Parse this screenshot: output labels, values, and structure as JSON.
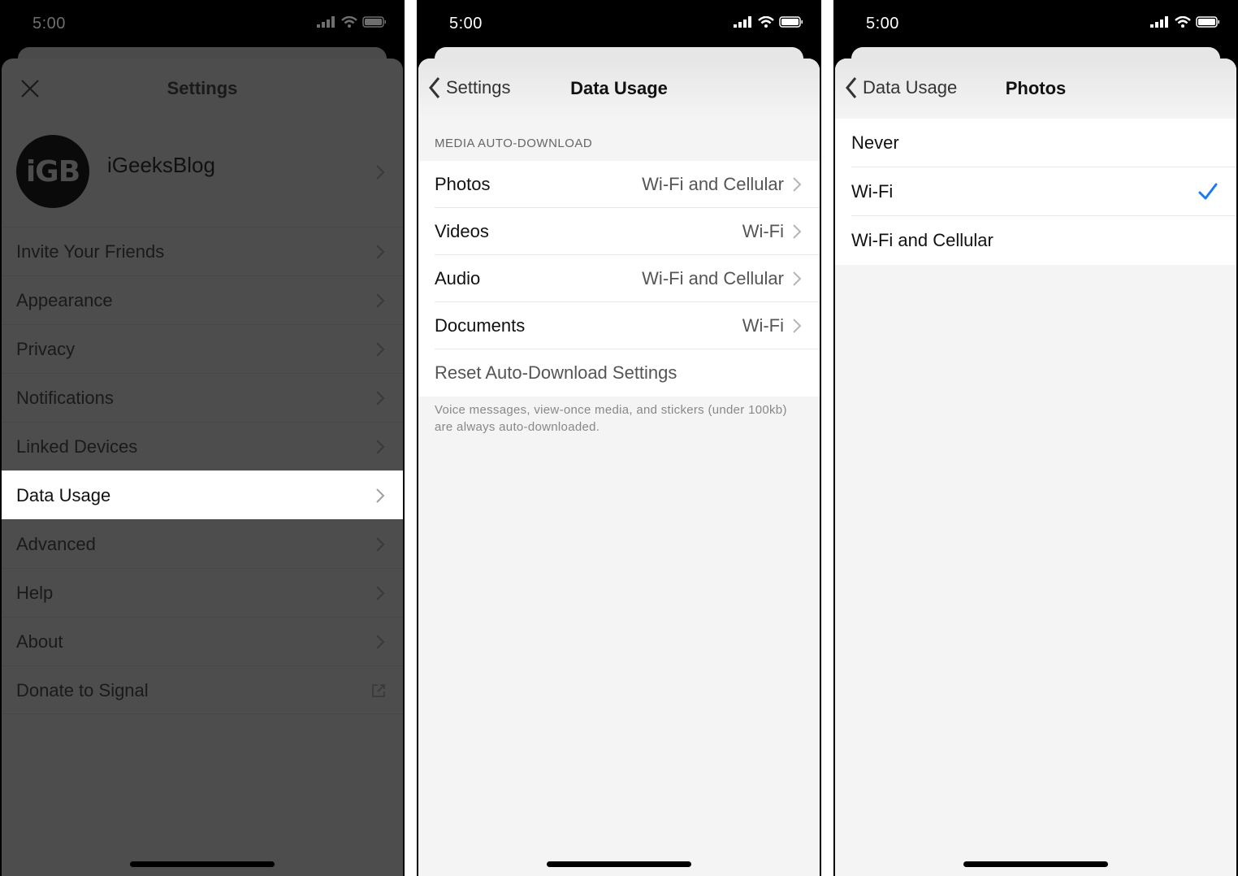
{
  "status_bar": {
    "time": "5:00"
  },
  "screen1": {
    "title": "Settings",
    "profile": {
      "avatar_text": "iGB",
      "name": "iGeeksBlog"
    },
    "items": [
      {
        "label": "Invite Your Friends",
        "icon": "chevron-right-icon"
      },
      {
        "label": "Appearance",
        "icon": "chevron-right-icon"
      },
      {
        "label": "Privacy",
        "icon": "chevron-right-icon"
      },
      {
        "label": "Notifications",
        "icon": "chevron-right-icon"
      },
      {
        "label": "Linked Devices",
        "icon": "chevron-right-icon"
      },
      {
        "label": "Data Usage",
        "icon": "chevron-right-icon",
        "highlighted": true
      },
      {
        "label": "Advanced",
        "icon": "chevron-right-icon"
      },
      {
        "label": "Help",
        "icon": "chevron-right-icon"
      },
      {
        "label": "About",
        "icon": "chevron-right-icon"
      },
      {
        "label": "Donate to Signal",
        "icon": "external-link-icon"
      }
    ]
  },
  "screen2": {
    "back_label": "Settings",
    "title": "Data Usage",
    "section_header": "MEDIA AUTO-DOWNLOAD",
    "rows": [
      {
        "label": "Photos",
        "value": "Wi-Fi and Cellular"
      },
      {
        "label": "Videos",
        "value": "Wi-Fi"
      },
      {
        "label": "Audio",
        "value": "Wi-Fi and Cellular"
      },
      {
        "label": "Documents",
        "value": "Wi-Fi"
      }
    ],
    "reset_label": "Reset Auto-Download Settings",
    "footer": "Voice messages, view-once media, and stickers (under 100kb) are always auto-downloaded."
  },
  "screen3": {
    "back_label": "Data Usage",
    "title": "Photos",
    "options": [
      {
        "label": "Never",
        "selected": false
      },
      {
        "label": "Wi-Fi",
        "selected": true
      },
      {
        "label": "Wi-Fi and Cellular",
        "selected": false
      }
    ]
  },
  "colors": {
    "accent": "#1a7cf0",
    "dim_overlay": "#4d4d4d",
    "highlight": "#ffffff"
  }
}
